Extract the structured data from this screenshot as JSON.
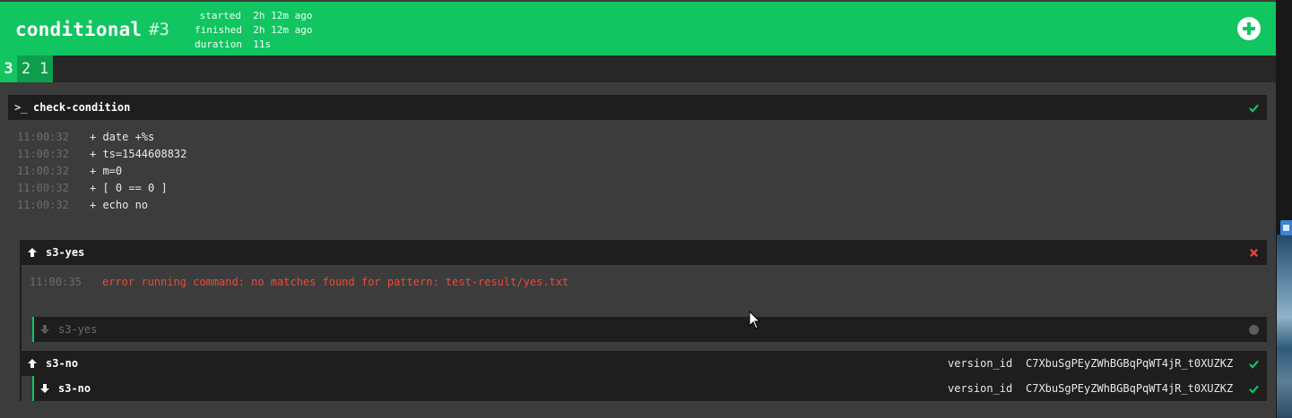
{
  "build": {
    "job_name": "conditional",
    "number": "#3",
    "started_label": "started",
    "started_value": "2h 12m ago",
    "finished_label": "finished",
    "finished_value": "2h 12m ago",
    "duration_label": "duration",
    "duration_value": "11s"
  },
  "build_tabs": [
    "3",
    "2",
    "1"
  ],
  "task": {
    "prompt": ">_",
    "name": "check-condition",
    "status": "succeeded",
    "log": [
      {
        "ts": "11:00:32",
        "text": "+ date +%s"
      },
      {
        "ts": "11:00:32",
        "text": "+ ts=1544608832"
      },
      {
        "ts": "11:00:32",
        "text": "+ m=0"
      },
      {
        "ts": "11:00:32",
        "text": "+ [ 0 == 0 ]"
      },
      {
        "ts": "11:00:32",
        "text": "+ echo no"
      }
    ]
  },
  "on_failure": {
    "put_name": "s3-yes",
    "put_status": "errored",
    "error_ts": "11:00:35",
    "error_text": "error running command: no matches found for pattern: test-result/yes.txt",
    "get_name": "s3-yes",
    "get_status": "pending"
  },
  "on_success": {
    "put_name": "s3-no",
    "put_version_key": "version_id",
    "put_version_value": "C7XbuSgPEyZWhBGBqPqWT4jR_t0XUZKZ",
    "get_name": "s3-no",
    "get_version_key": "version_id",
    "get_version_value": "C7XbuSgPEyZWhBGBqPqWT4jR_t0XUZKZ"
  },
  "colors": {
    "succeeded": "#11c560",
    "failed": "#e74c3c",
    "header_bg": "#11c560",
    "page_bg": "#3d3c3c",
    "step_bg": "#1e1e1e"
  }
}
